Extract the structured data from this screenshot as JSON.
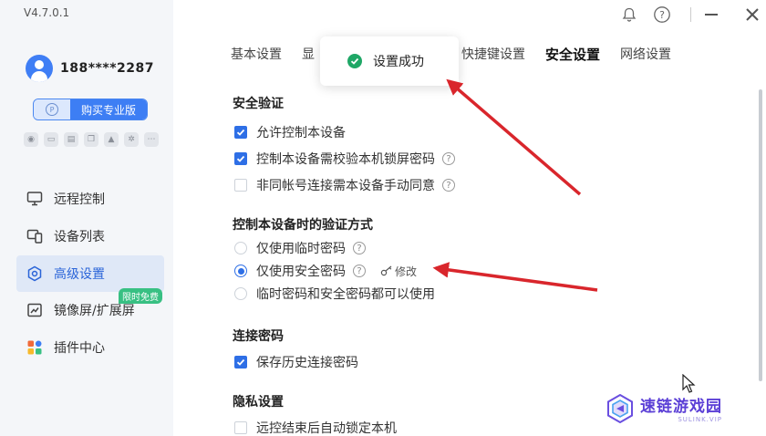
{
  "app": {
    "version": "V4.7.0.1",
    "user": {
      "phone": "188****2287"
    },
    "buy_label": "购买专业版",
    "buy_icon": "P"
  },
  "sidebar": {
    "items": [
      {
        "label": "远程控制",
        "icon": "monitor-icon"
      },
      {
        "label": "设备列表",
        "icon": "devices-icon"
      },
      {
        "label": "高级设置",
        "icon": "settings-icon",
        "active": true
      },
      {
        "label": "镜像屏/扩展屏",
        "icon": "mirror-icon",
        "badge": "限时免费"
      },
      {
        "label": "插件中心",
        "icon": "plugin-icon"
      }
    ]
  },
  "tabs": [
    {
      "label": "基本设置"
    },
    {
      "label": "显"
    },
    {
      "label": "快捷键设置"
    },
    {
      "label": "安全设置",
      "active": true
    },
    {
      "label": "网络设置"
    }
  ],
  "toast": {
    "text": "设置成功"
  },
  "sections": {
    "security_verify": {
      "title": "安全验证",
      "options": [
        {
          "label": "允许控制本设备",
          "checked": true
        },
        {
          "label": "控制本设备需校验本机锁屏密码",
          "checked": true,
          "help": true
        },
        {
          "label": "非同帐号连接需本设备手动同意",
          "checked": false,
          "help": true
        }
      ]
    },
    "verify_method": {
      "title": "控制本设备时的验证方式",
      "options": [
        {
          "label": "仅使用临时密码",
          "checked": false,
          "help": true
        },
        {
          "label": "仅使用安全密码",
          "checked": true,
          "help": true,
          "modify": "修改"
        },
        {
          "label": "临时密码和安全密码都可以使用",
          "checked": false
        }
      ]
    },
    "conn_password": {
      "title": "连接密码",
      "options": [
        {
          "label": "保存历史连接密码",
          "checked": true
        }
      ]
    },
    "privacy": {
      "title": "隐私设置",
      "options": [
        {
          "label": "远控结束后自动锁定本机",
          "checked": false
        }
      ]
    }
  },
  "help_glyph": "?",
  "watermark": {
    "main": "速链游戏园",
    "sub": "SULINK.VIP"
  },
  "colors": {
    "accent": "#2e6fe6",
    "success": "#1fa766",
    "badge": "#38c083",
    "arrow": "#d9262c"
  }
}
